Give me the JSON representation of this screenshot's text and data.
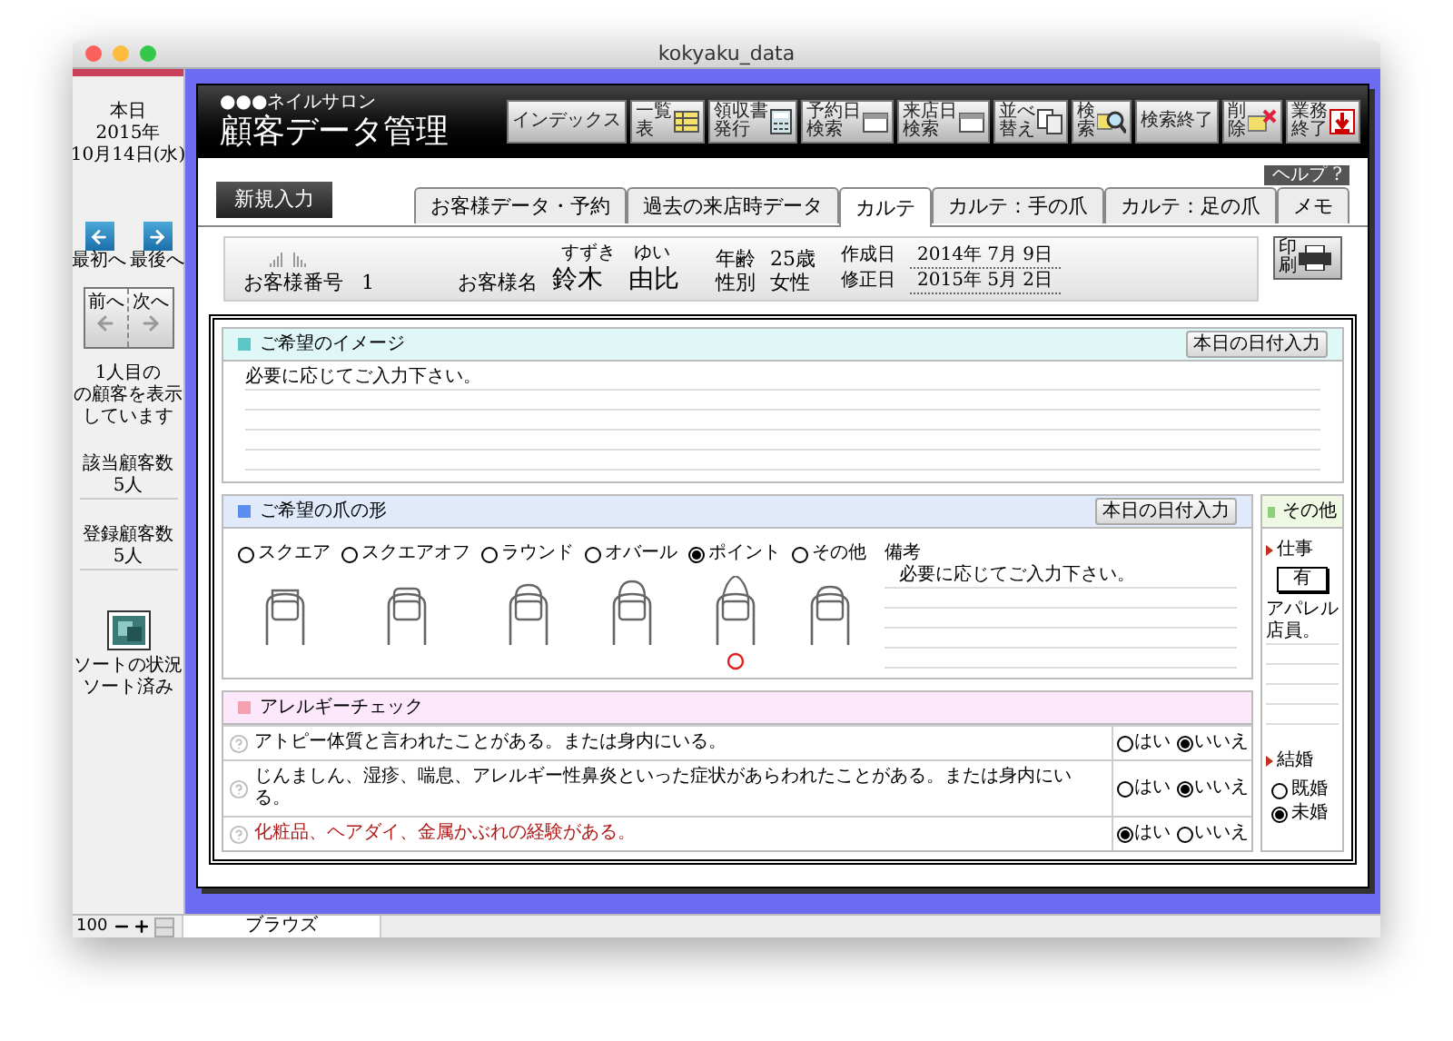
{
  "window": {
    "title": "kokyaku_data"
  },
  "sidebar": {
    "today_label": "本日",
    "today_year": "2015年",
    "today_date": "10月14日(水)",
    "nav_buttons": [
      {
        "label": "最初へ",
        "kind": "first"
      },
      {
        "label": "最後へ",
        "kind": "last"
      }
    ],
    "page_buttons": [
      {
        "label": "前へ",
        "kind": "prev"
      },
      {
        "label": "次へ",
        "kind": "next"
      }
    ],
    "record_status": [
      "1人目の",
      "の顧客を表示",
      "しています"
    ],
    "counts": [
      {
        "label": "該当顧客数",
        "value": "5人"
      },
      {
        "label": "登録顧客数",
        "value": "5人"
      }
    ],
    "sort_status": [
      "ソートの状況",
      "ソート済み"
    ]
  },
  "header": {
    "subtitle": "●●●ネイルサロン",
    "title": "顧客データ管理",
    "toolbar": [
      {
        "label": "インデックス",
        "kind": "index"
      },
      {
        "label": "一覧表",
        "kind": "list"
      },
      {
        "label": "領収書発行",
        "kind": "receipt"
      },
      {
        "label": "予約日検索",
        "kind": "reserve_search"
      },
      {
        "label": "来店日検索",
        "kind": "visit_search"
      },
      {
        "label": "並べ替え",
        "kind": "sort"
      },
      {
        "label": "検索",
        "kind": "search"
      },
      {
        "label": "検索終了",
        "kind": "search_end"
      },
      {
        "label": "削除",
        "kind": "delete"
      },
      {
        "label": "業務終了",
        "kind": "quit"
      }
    ]
  },
  "new_entry_button": "新規入力",
  "help_button": "ヘルプ ?",
  "tabs": [
    {
      "label": "お客様データ・予約",
      "selected": false
    },
    {
      "label": "過去の来店時データ",
      "selected": false
    },
    {
      "label": "カルテ",
      "selected": true
    },
    {
      "label": "カルテ：手の爪",
      "selected": false
    },
    {
      "label": "カルテ：足の爪",
      "selected": false
    },
    {
      "label": "メモ",
      "selected": false
    }
  ],
  "customer": {
    "number_label": "お客様番号",
    "number": "1",
    "name_label": "お客様名",
    "furigana": "すずき　ゆい",
    "name": "鈴木　由比",
    "age_label": "年齢",
    "age": "25歳",
    "gender_label": "性別",
    "gender": "女性",
    "created_label": "作成日",
    "created": "2014年 7月 9日",
    "modified_label": "修正日",
    "modified": "2015年 5月 2日"
  },
  "print_button": "印刷",
  "image_section": {
    "title": "ご希望のイメージ",
    "date_button": "本日の日付入力",
    "text": "必要に応じてご入力下さい。"
  },
  "shape_section": {
    "title": "ご希望の爪の形",
    "date_button": "本日の日付入力",
    "shapes": [
      {
        "label": "スクエア",
        "kind": "square",
        "selected": false
      },
      {
        "label": "スクエアオフ",
        "kind": "square_off",
        "selected": false
      },
      {
        "label": "ラウンド",
        "kind": "round",
        "selected": false
      },
      {
        "label": "オバール",
        "kind": "oval",
        "selected": false
      },
      {
        "label": "ポイント",
        "kind": "point",
        "selected": true
      },
      {
        "label": "その他",
        "kind": "other",
        "selected": false
      }
    ],
    "notes_label": "備考",
    "notes": "必要に応じてご入力下さい。"
  },
  "other_section": {
    "title": "その他",
    "job_label": "仕事",
    "job_flag": "有",
    "job_text": "アパレル店員。",
    "marriage_label": "結婚",
    "marriage_options": [
      {
        "label": "既婚",
        "selected": false
      },
      {
        "label": "未婚",
        "selected": true
      }
    ]
  },
  "allergy_section": {
    "title": "アレルギーチェック",
    "questions": [
      {
        "text": "アトピー体質と言われたことがある。または身内にいる。",
        "options": [
          {
            "label": "はい",
            "selected": false
          },
          {
            "label": "いいえ",
            "selected": true
          }
        ]
      },
      {
        "text": "じんましん、湿疹、喘息、アレルギー性鼻炎といった症状があらわれたことがある。または身内にいる。",
        "options": [
          {
            "label": "はい",
            "selected": false
          },
          {
            "label": "いいえ",
            "selected": true
          }
        ]
      },
      {
        "text": "化粧品、ヘアダイ、金属かぶれの経験がある。",
        "options": [
          {
            "label": "はい",
            "selected": true
          },
          {
            "label": "いいえ",
            "selected": false
          }
        ]
      }
    ]
  },
  "status_bar": {
    "zoom": "100",
    "mode": "ブラウズ"
  }
}
